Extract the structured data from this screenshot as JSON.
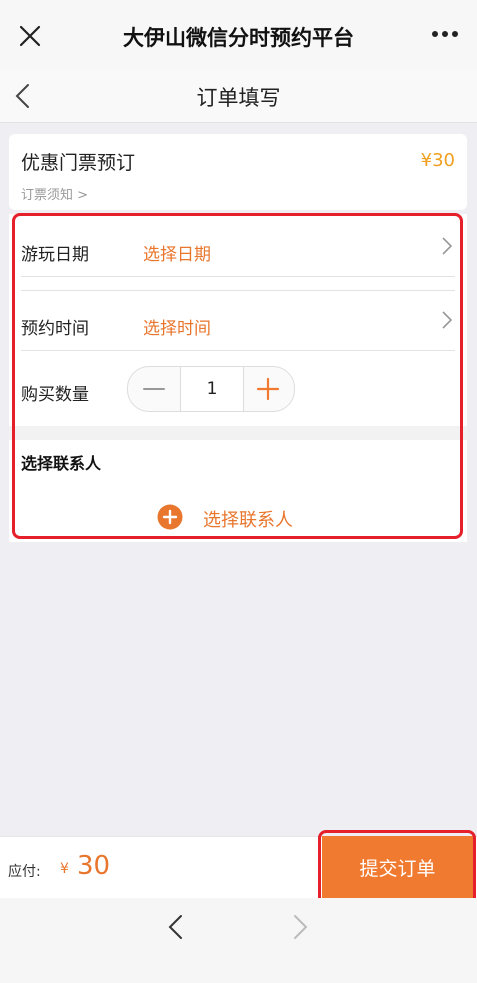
{
  "app": {
    "title": "大伊山微信分时预约平台",
    "close_icon": "close-icon",
    "more_icon": "more-icon"
  },
  "nav": {
    "title": "订单填写",
    "back_icon": "chevron-left-icon"
  },
  "ticket": {
    "name": "优惠门票预订",
    "price": "¥30",
    "notice": "订票须知 >"
  },
  "form": {
    "date_label": "游玩日期",
    "date_value": "选择日期",
    "time_label": "预约时间",
    "time_value": "选择时间",
    "quantity_label": "购买数量",
    "quantity_value": "1",
    "contact_section_title": "选择联系人",
    "add_contact_label": "选择联系人"
  },
  "footer": {
    "pay_label": "应付:",
    "currency": "¥",
    "amount": "30",
    "submit_label": "提交订单"
  },
  "colors": {
    "accent": "#e8762d",
    "price": "#f0a020",
    "submit_bg": "#f07b30",
    "highlight": "#e5202a"
  }
}
